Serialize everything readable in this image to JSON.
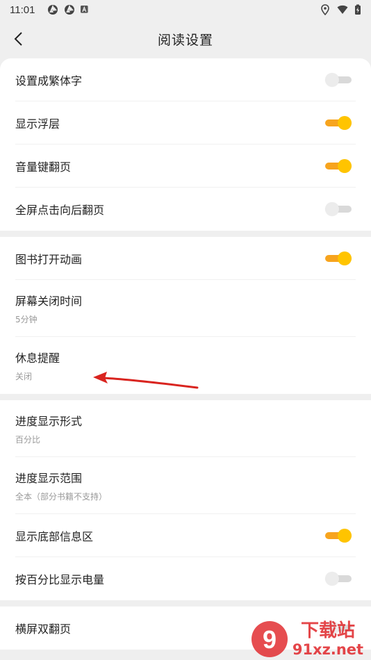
{
  "status": {
    "time": "11:01",
    "icons_left": [
      "aperture-icon",
      "aperture-icon",
      "a-icon"
    ],
    "icons_right": [
      "location-icon",
      "wifi-icon",
      "battery-icon"
    ]
  },
  "nav": {
    "title": "阅读设置",
    "back_icon": "chevron-left-icon"
  },
  "groups": [
    {
      "rows": [
        {
          "label": "设置成繁体字",
          "toggle": false
        },
        {
          "label": "显示浮层",
          "toggle": true
        },
        {
          "label": "音量键翻页",
          "toggle": true
        },
        {
          "label": "全屏点击向后翻页",
          "toggle": false
        }
      ]
    },
    {
      "rows": [
        {
          "label": "图书打开动画",
          "toggle": true
        },
        {
          "label": "屏幕关闭时间",
          "sub": "5分钟"
        },
        {
          "label": "休息提醒",
          "sub": "关闭"
        }
      ]
    },
    {
      "rows": [
        {
          "label": "进度显示形式",
          "sub": "百分比"
        },
        {
          "label": "进度显示范围",
          "sub": "全本（部分书籍不支持）"
        },
        {
          "label": "显示底部信息区",
          "toggle": true
        },
        {
          "label": "按百分比显示电量",
          "toggle": false
        }
      ]
    },
    {
      "rows": [
        {
          "label": "横屏双翻页",
          "toggle": false
        }
      ]
    }
  ],
  "watermark": {
    "text_top": "下载站",
    "text_bottom": "91xz.net",
    "logo_number": "9"
  },
  "colors": {
    "toggle_on_track": "#f7a41e",
    "toggle_on_knob": "#ffc400",
    "toggle_off_track": "#d9d9d9",
    "annotation_arrow": "#d9241f",
    "watermark_red": "#e0262a"
  }
}
